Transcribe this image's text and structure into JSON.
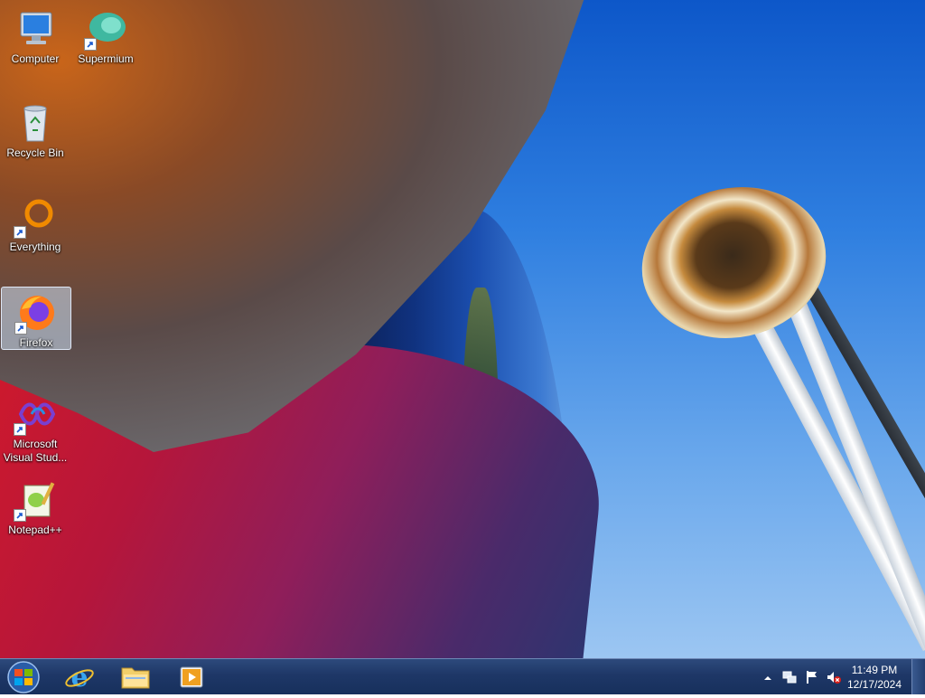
{
  "desktop": {
    "icons": [
      {
        "label": "Computer",
        "icon": "computer-icon"
      },
      {
        "label": "Supermium",
        "icon": "supermium-icon"
      },
      {
        "label": "Recycle Bin",
        "icon": "recycle-bin-icon"
      },
      {
        "label": "Everything",
        "icon": "everything-search-icon"
      },
      {
        "label": "Firefox",
        "icon": "firefox-icon",
        "selected": true
      },
      {
        "label": "Microsoft Visual Stud...",
        "icon": "visual-studio-icon"
      },
      {
        "label": "Notepad++",
        "icon": "notepad-plus-plus-icon"
      }
    ]
  },
  "taskbar": {
    "pinned": [
      {
        "name": "start-button",
        "icon": "windows-orb-icon"
      },
      {
        "name": "internet-explorer",
        "icon": "internet-explorer-icon"
      },
      {
        "name": "windows-explorer",
        "icon": "folder-icon"
      },
      {
        "name": "media-player",
        "icon": "media-player-icon"
      }
    ],
    "tray": {
      "time": "11:49 PM",
      "date": "12/17/2024",
      "icons": [
        "show-hidden-icons-arrow",
        "network-icon",
        "action-center-flag-icon",
        "volume-muted-icon"
      ]
    }
  },
  "colors": {
    "taskbar": "#1e3767",
    "selection": "#cde1f5",
    "sky": "#2f7fe0"
  }
}
